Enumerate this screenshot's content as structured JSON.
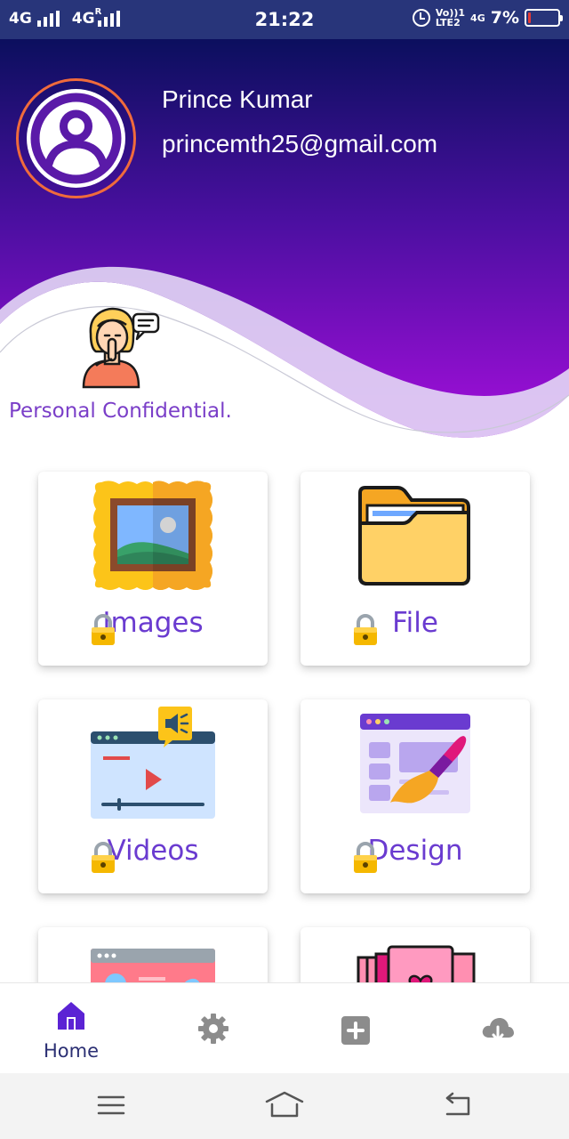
{
  "status_bar": {
    "sim1": "4G",
    "sim2": "4G",
    "sim2_roaming": "R",
    "time": "21:22",
    "volte_top": "Vo))1",
    "volte_bottom": "LTE2",
    "net": "4G",
    "battery_percent": "7%",
    "battery_level": 0.07
  },
  "profile": {
    "name": "Prince Kumar",
    "email": "princemth25@gmail.com",
    "tagline": "Personal Confidential."
  },
  "cards": [
    {
      "label": "Images",
      "icon": "framed-picture-icon",
      "locked": true
    },
    {
      "label": "File",
      "icon": "folder-icon",
      "locked": true
    },
    {
      "label": "Videos",
      "icon": "video-player-icon",
      "locked": true
    },
    {
      "label": "Design",
      "icon": "design-brush-icon",
      "locked": true
    },
    {
      "label": "",
      "icon": "web-profile-icon",
      "locked": true
    },
    {
      "label": "",
      "icon": "books-heart-icon",
      "locked": true
    }
  ],
  "bottom_nav": {
    "items": [
      {
        "label": "Home",
        "icon": "home-icon",
        "active": true
      },
      {
        "label": "",
        "icon": "settings-gear-icon",
        "active": false
      },
      {
        "label": "",
        "icon": "add-square-icon",
        "active": false
      },
      {
        "label": "",
        "icon": "cloud-download-icon",
        "active": false
      }
    ]
  },
  "colors": {
    "header_top": "#0b0f5e",
    "header_bottom": "#a50fdc",
    "accent_text": "#6a3bd0",
    "status_bar": "#28357a",
    "avatar_ring": "#f06b3c",
    "nav_active": "#5b23d4",
    "nav_inactive": "#8c8c8c"
  }
}
